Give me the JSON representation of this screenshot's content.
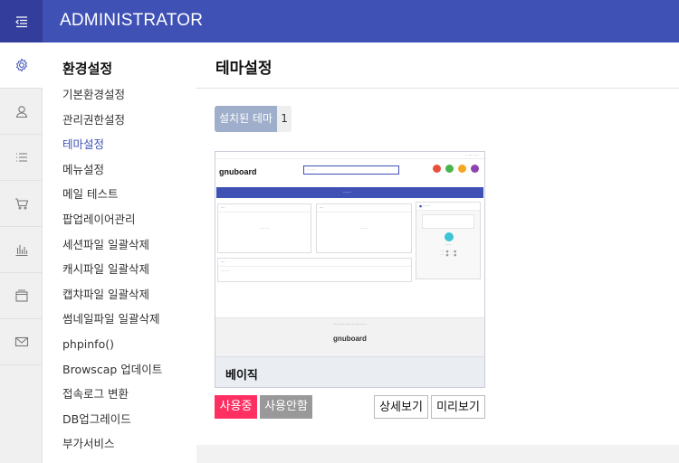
{
  "header": {
    "brand": "ADMINISTRATOR"
  },
  "rail": [
    {
      "icon": "gear-icon",
      "active": true
    },
    {
      "icon": "user-icon"
    },
    {
      "icon": "list-icon"
    },
    {
      "icon": "cart-icon"
    },
    {
      "icon": "bar-chart-icon"
    },
    {
      "icon": "window-icon"
    },
    {
      "icon": "mail-icon"
    }
  ],
  "submenu": {
    "title": "환경설정",
    "items": [
      "기본환경설정",
      "관리권한설정",
      "테마설정",
      "메뉴설정",
      "메일 테스트",
      "팝업레이어관리",
      "세션파일 일괄삭제",
      "캐시파일 일괄삭제",
      "캡챠파일 일괄삭제",
      "썸네일파일 일괄삭제",
      "phpinfo()",
      "Browscap 업데이트",
      "접속로그 변환",
      "DB업그레이드",
      "부가서비스"
    ],
    "active_index": 2
  },
  "main": {
    "title": "테마설정",
    "installed_label": "설치된 테마",
    "installed_count": "1",
    "theme": {
      "name": "베이직",
      "btn_in_use": "사용중",
      "btn_disable": "사용안함",
      "btn_detail": "상세보기",
      "btn_preview": "미리보기"
    },
    "thumbnail": {
      "logo": "gnuboard",
      "footer_logo": "gnuboard"
    }
  },
  "colors": {
    "header": "#3f51b5",
    "accent": "#3f51b5",
    "in_use": "#ff3061",
    "installed_label_bg": "#9eaecb"
  }
}
